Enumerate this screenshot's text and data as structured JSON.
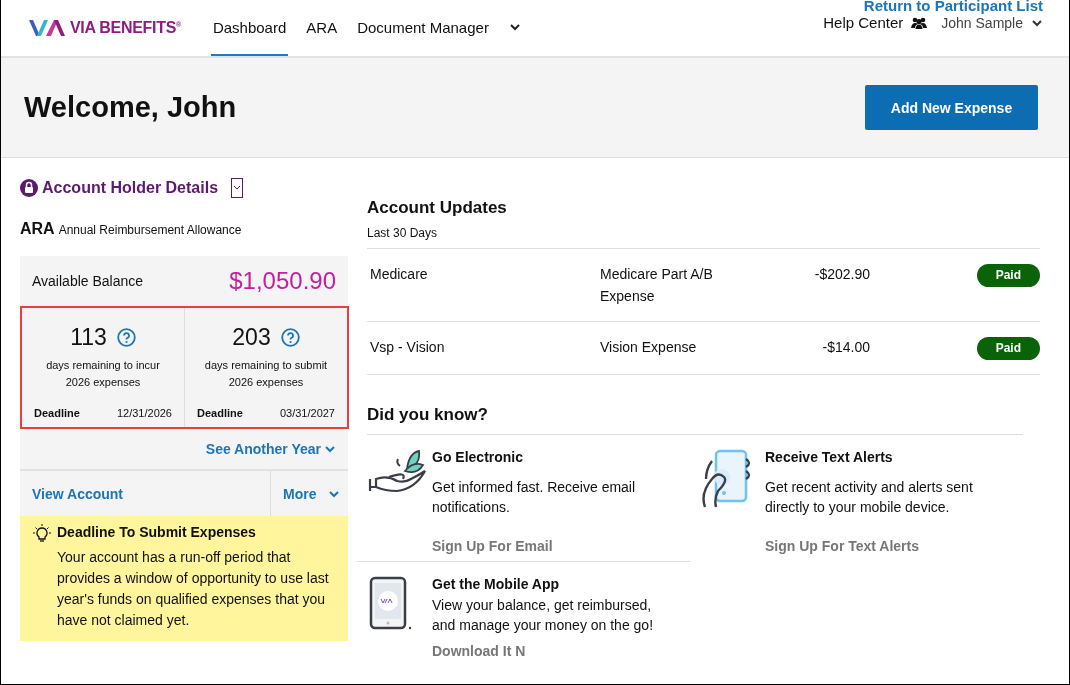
{
  "header": {
    "logo": "VIA BENEFITS$^{®}$",
    "nav": [
      {
        "label": "Dashboard",
        "selected": true
      },
      {
        "label": "ARA",
        "selected": false
      },
      {
        "label": "Document Manager",
        "selected": false
      }
    ],
    "return_link": "Return to Participant List",
    "help": "Help Center",
    "user": "John Sample"
  },
  "banner": {
    "greeting": "Welcome, John",
    "button": "Add New Expense"
  },
  "account": {
    "title": "Account Holder Details",
    "plan_code": "ARA",
    "plan_name": "Annual Reimbursement Allowance",
    "balance_label": "Available Balance",
    "balance": "$1,050.90",
    "counters": [
      {
        "days": "113",
        "text": "days remaining to incur 2026 expenses",
        "deadline_label": "Deadline",
        "deadline": "12/31/2026"
      },
      {
        "days": "203",
        "text": "days remaining to submit 2026 expenses",
        "deadline_label": "Deadline",
        "deadline": "03/31/2027"
      }
    ],
    "another_year": "See Another Year",
    "view_account": "View Account",
    "more": "More",
    "notice": {
      "title": "Deadline To Submit Expenses",
      "text": "Your account has a run-off period that provides a window of opportunity to use last year's funds on qualified expenses that you have not claimed yet."
    }
  },
  "updates": {
    "title": "Account Updates",
    "period": "Last 30 Days",
    "rows": [
      {
        "payee": "Medicare",
        "description": "Medicare Part A/B Expense",
        "amount": "-$202.90",
        "status": "Paid"
      },
      {
        "payee": "Vsp - Vision",
        "description": "Vision Expense",
        "amount": "-$14.00",
        "status": "Paid"
      }
    ]
  },
  "tips": {
    "title": "Did you know?",
    "items": [
      {
        "kind": "leaf",
        "title": "Go Electronic",
        "text": "Get informed fast. Receive email notifications.",
        "link": "Sign Up For Email"
      },
      {
        "kind": "hand-phone",
        "title": "Receive Text Alerts",
        "text": "Get recent activity and alerts sent directly to your mobile device.",
        "link": "Sign Up For Text Alerts"
      },
      {
        "kind": "phone",
        "title": "Get the Mobile App",
        "text": "View your balance, get reimbursed, and manage your money on the go!",
        "link": "Download It N"
      }
    ]
  }
}
